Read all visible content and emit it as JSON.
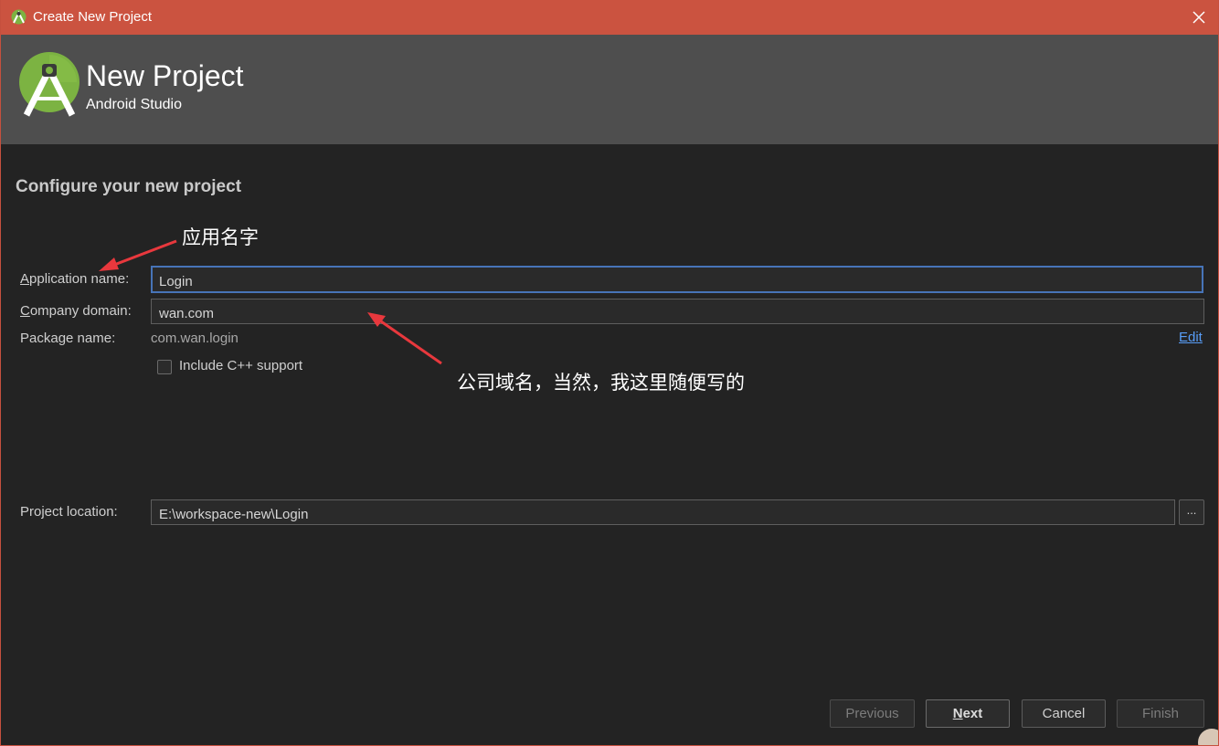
{
  "window": {
    "title": "Create New Project",
    "icon": "android-studio-icon",
    "close_icon": "close-icon"
  },
  "banner": {
    "title": "New Project",
    "subtitle": "Android Studio",
    "logo": "android-studio-logo"
  },
  "form": {
    "section_title": "Configure your new project",
    "application_name": {
      "label_mnemonic": "A",
      "label_rest": "pplication name:",
      "value": "Login"
    },
    "company_domain": {
      "label_mnemonic": "C",
      "label_rest": "ompany domain:",
      "value": "wan.com"
    },
    "package_name": {
      "label": "Package name:",
      "value": "com.wan.login",
      "edit_label": "Edit"
    },
    "cpp_support": {
      "label": "Include C++ support",
      "checked": false
    },
    "project_location": {
      "label": "Project location:",
      "value": "E:\\workspace-new\\Login",
      "browse_label": "..."
    }
  },
  "annotations": {
    "app_name_note": "应用名字",
    "domain_note": "公司域名，当然，我这里随便写的",
    "arrow_color": "#e8383d"
  },
  "buttons": {
    "previous": "Previous",
    "next_mnemonic": "N",
    "next_rest": "ext",
    "cancel": "Cancel",
    "finish": "Finish"
  },
  "colors": {
    "titlebar": "#cb5340",
    "banner": "#4e4e4e",
    "background": "#232323",
    "focus_border": "#4774b8",
    "link": "#589df6"
  }
}
